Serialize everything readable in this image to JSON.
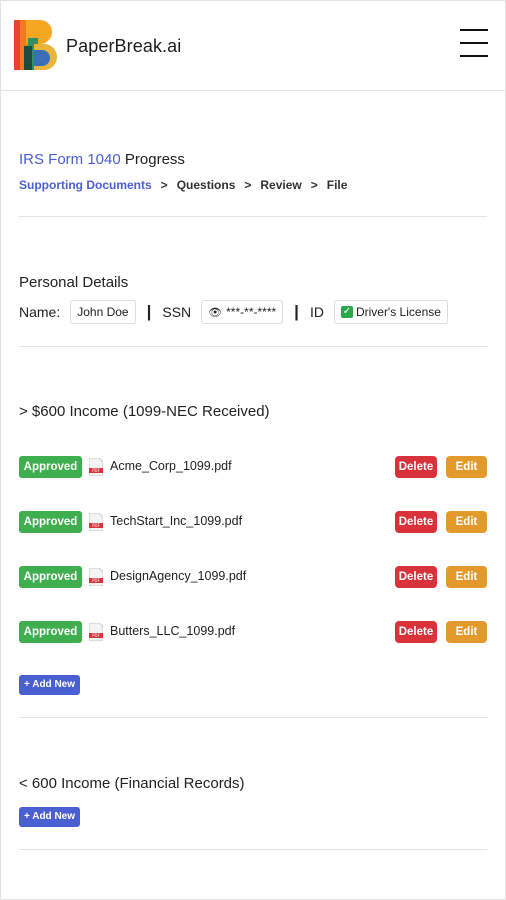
{
  "brand": {
    "name": "PaperBreak.ai"
  },
  "progress": {
    "form_name": "IRS Form 1040",
    "title_suffix": " Progress",
    "steps": [
      "Supporting Documents",
      "Questions",
      "Review",
      "File"
    ],
    "separator": ">"
  },
  "personal": {
    "heading": "Personal Details",
    "name_label": "Name:",
    "name_value": "John Doe",
    "ssn_label": "SSN",
    "ssn_value": "***-**-****",
    "id_label": "ID",
    "id_value": "Driver's License",
    "divider": "|"
  },
  "income_over": {
    "heading": "> $600 Income (1099-NEC Received)",
    "documents": [
      {
        "status": "Approved",
        "file": "Acme_Corp_1099.pdf"
      },
      {
        "status": "Approved",
        "file": "TechStart_Inc_1099.pdf"
      },
      {
        "status": "Approved",
        "file": "DesignAgency_1099.pdf"
      },
      {
        "status": "Approved",
        "file": "Butters_LLC_1099.pdf"
      }
    ],
    "delete_label": "Delete",
    "edit_label": "Edit",
    "add_label": "+ Add New"
  },
  "income_under": {
    "heading": "< 600 Income (Financial Records)",
    "add_label": "+ Add New"
  },
  "colors": {
    "accent": "#4a5fd1",
    "approved": "#3fae4f",
    "delete": "#d8323a",
    "edit": "#e39a2c"
  },
  "icons": {
    "menu": "hamburger-icon",
    "file": "pdf-file-icon",
    "ssn": "eye-icon",
    "id": "check-icon"
  }
}
